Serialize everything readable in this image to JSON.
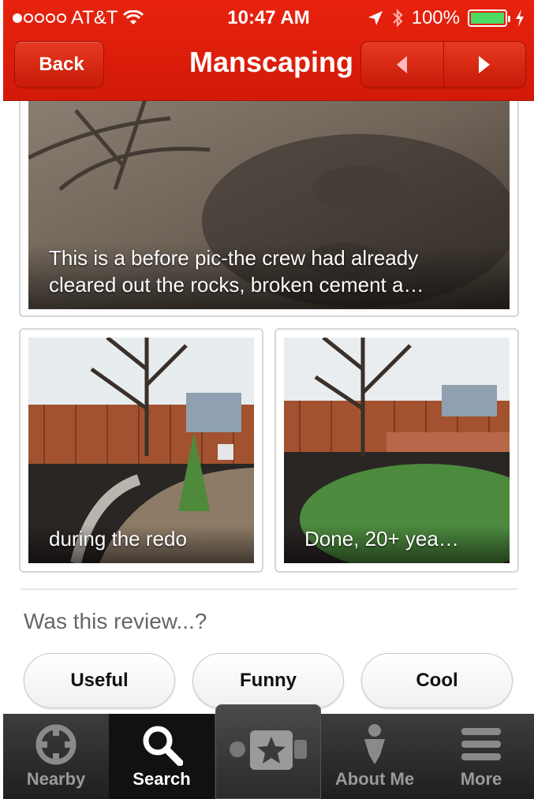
{
  "status_bar": {
    "carrier": "AT&T",
    "time": "10:47 AM",
    "battery": "100%"
  },
  "nav": {
    "back_label": "Back",
    "title": "Manscaping"
  },
  "photos": {
    "main_caption_line1": "This is a before pic-the crew had already",
    "main_caption_line2": "cleared out the rocks, broken cement a…",
    "left_caption": "during the redo",
    "right_caption": "Done, 20+ yea…"
  },
  "review": {
    "question": "Was this review...?",
    "useful_label": "Useful",
    "funny_label": "Funny",
    "cool_label": "Cool"
  },
  "tabs": [
    {
      "label": "Nearby",
      "icon": "crosshair-icon"
    },
    {
      "label": "Search",
      "icon": "search-icon",
      "active": true
    },
    {
      "label": "",
      "icon": "camera-star-icon"
    },
    {
      "label": "About Me",
      "icon": "person-icon"
    },
    {
      "label": "More",
      "icon": "menu-icon"
    }
  ],
  "colors": {
    "brand_red": "#d21a08",
    "battery_green": "#4cd964",
    "tabbar_dark": "#1f1f1f"
  }
}
